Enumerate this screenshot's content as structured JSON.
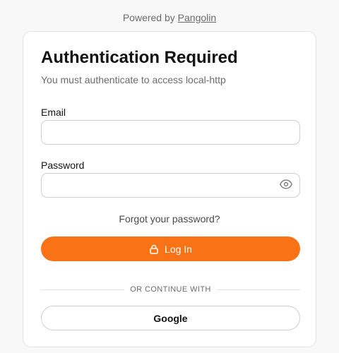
{
  "header": {
    "powered_prefix": "Powered by",
    "powered_brand": "Pangolin"
  },
  "auth": {
    "title": "Authentication Required",
    "subtitle": "You must authenticate to access local-http",
    "email_label": "Email",
    "email_value": "",
    "password_label": "Password",
    "password_value": "",
    "password_toggle_icon": "eye-icon",
    "forgot_link": "Forgot your password?",
    "login_button": "Log In",
    "login_icon": "lock-icon",
    "divider_text": "OR CONTINUE WITH",
    "google_button": "Google"
  },
  "colors": {
    "accent": "#f97316",
    "background": "#f8f8f8",
    "card": "#ffffff",
    "muted_text": "#6b6b6b",
    "border": "#cfcfcf"
  }
}
